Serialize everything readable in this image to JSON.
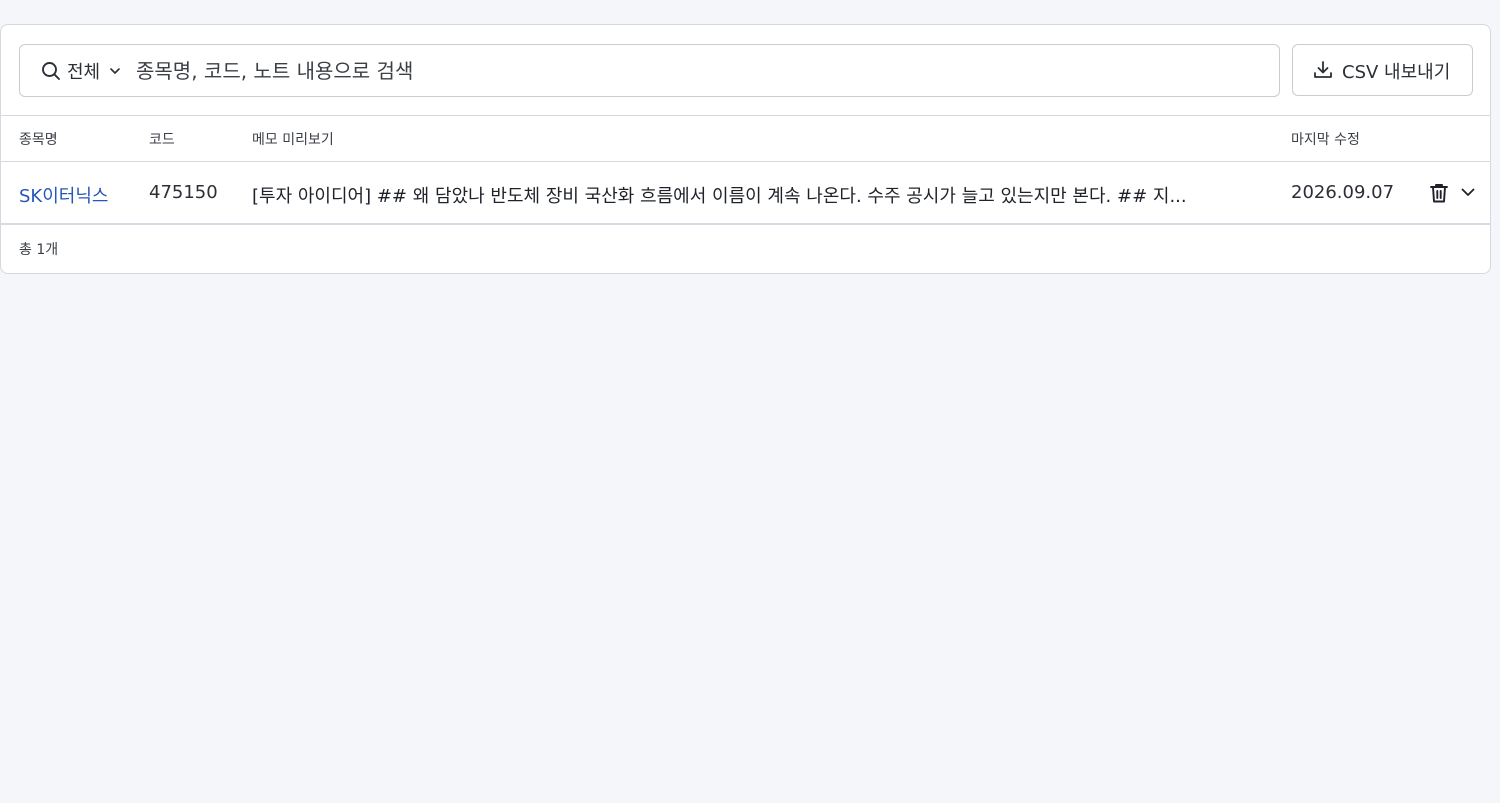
{
  "toolbar": {
    "scope_label": "전체",
    "search_placeholder": "종목명, 코드, 노트 내용으로 검색",
    "export_label": "CSV 내보내기",
    "icons": {
      "search": "search-icon",
      "scope_chevron": "chevron-down-icon",
      "export": "download-icon"
    }
  },
  "table": {
    "columns": [
      "종목명",
      "코드",
      "메모 미리보기",
      "마지막 수정"
    ],
    "rows": [
      {
        "name": "SK이터닉스",
        "code": "475150",
        "memo": "[투자 아이디어] ## 왜 담았나 반도체 장비 국산화 흐름에서 이름이 계속 나온다. 수주 공시가 늘고 있는지만 본다. ## 지...",
        "updated": "2026.09.07",
        "actions": [
          "trash-icon",
          "chevron-down-icon"
        ]
      }
    ]
  },
  "footer": {
    "total": "총 1개"
  },
  "colors": {
    "background": "#f5f6fa",
    "link": "#2457b8",
    "border": "#d5d8de"
  }
}
